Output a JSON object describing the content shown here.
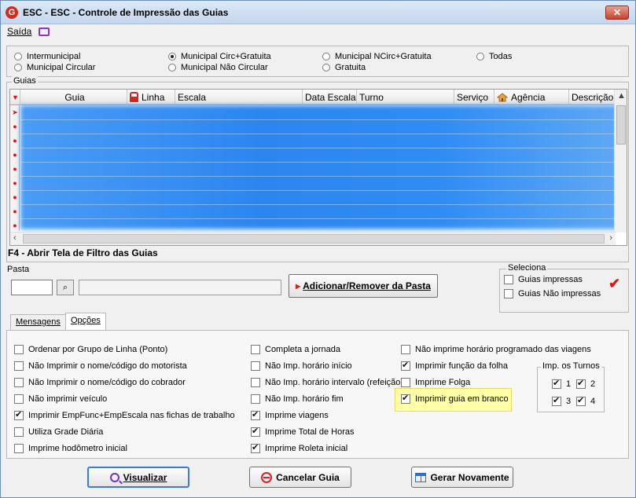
{
  "window": {
    "title": "ESC -  ESC - Controle de Impressão das Guias",
    "close_label": "✕",
    "app_icon": "G"
  },
  "menu": {
    "items": [
      {
        "label": "Saída"
      }
    ]
  },
  "filters": {
    "options": [
      {
        "label": "Intermunicipal",
        "checked": false
      },
      {
        "label": "Municipal Circular",
        "checked": false
      },
      {
        "label": "Municipal Circ+Gratuita",
        "checked": true
      },
      {
        "label": "Municipal Não Circular",
        "checked": false
      },
      {
        "label": "Municipal NCirc+Gratuita",
        "checked": false
      },
      {
        "label": "Gratuita",
        "checked": false
      },
      {
        "label": "Todas",
        "checked": false
      }
    ]
  },
  "guias": {
    "legend": "Guias",
    "columns": [
      "Guia",
      "Linha",
      "Escala",
      "Data Escala",
      "Turno",
      "Serviço",
      "Agência",
      "Descrição da"
    ],
    "f4_hint": "F4 - Abrir Tela de Filtro das Guias"
  },
  "pasta": {
    "legend": "Pasta",
    "add_button": "Adicionar/Remover da Pasta"
  },
  "seleciona": {
    "legend": "Seleciona",
    "options": [
      {
        "label": "Guias impressas",
        "checked": false
      },
      {
        "label": "Guias Não impressas",
        "checked": false
      }
    ],
    "check_mark": "✔"
  },
  "tabs": [
    {
      "label": "Mensagens",
      "active": false
    },
    {
      "label": "Opções",
      "active": true
    }
  ],
  "options": {
    "col1": [
      {
        "label": "Ordenar por Grupo de Linha (Ponto)",
        "checked": false
      },
      {
        "label": "Não Imprimir o nome/código do motorista",
        "checked": false
      },
      {
        "label": "Não Imprimir o nome/código do cobrador",
        "checked": false
      },
      {
        "label": "Não imprimir veículo",
        "checked": false
      },
      {
        "label": "Imprimir EmpFunc+EmpEscala nas fichas de trabalho",
        "checked": true
      },
      {
        "label": "Utiliza Grade Diária",
        "checked": false
      },
      {
        "label": "Imprime hodômetro inicial",
        "checked": false
      }
    ],
    "col2": [
      {
        "label": "Completa a jornada",
        "checked": false
      },
      {
        "label": "Não Imp. horário início",
        "checked": false
      },
      {
        "label": "Não Imp. horário intervalo (refeição)",
        "checked": false
      },
      {
        "label": "Não Imp. horário fim",
        "checked": false
      },
      {
        "label": "Imprime viagens",
        "checked": true
      },
      {
        "label": "Imprime Total de Horas",
        "checked": true
      },
      {
        "label": "Imprime Roleta inicial",
        "checked": true
      }
    ],
    "col3": [
      {
        "label": "Não imprime horário programado das viagens",
        "checked": false
      },
      {
        "label": "Imprimir função da folha",
        "checked": true
      },
      {
        "label": "Imprime Folga",
        "checked": false
      },
      {
        "label": "Imprimir guia em branco",
        "checked": true
      }
    ],
    "turnos": {
      "legend": "Imp. os Turnos",
      "items": [
        {
          "label": "1",
          "checked": true
        },
        {
          "label": "2",
          "checked": true
        },
        {
          "label": "3",
          "checked": true
        },
        {
          "label": "4",
          "checked": true
        }
      ]
    }
  },
  "buttons": {
    "visualizar": "Visualizar",
    "cancelar": "Cancelar Guia",
    "gerar": "Gerar Novamente"
  },
  "colors": {
    "accent_red": "#d42a1e",
    "selection_blue": "#2c86f0",
    "highlight_yellow": "#ffffa8"
  }
}
